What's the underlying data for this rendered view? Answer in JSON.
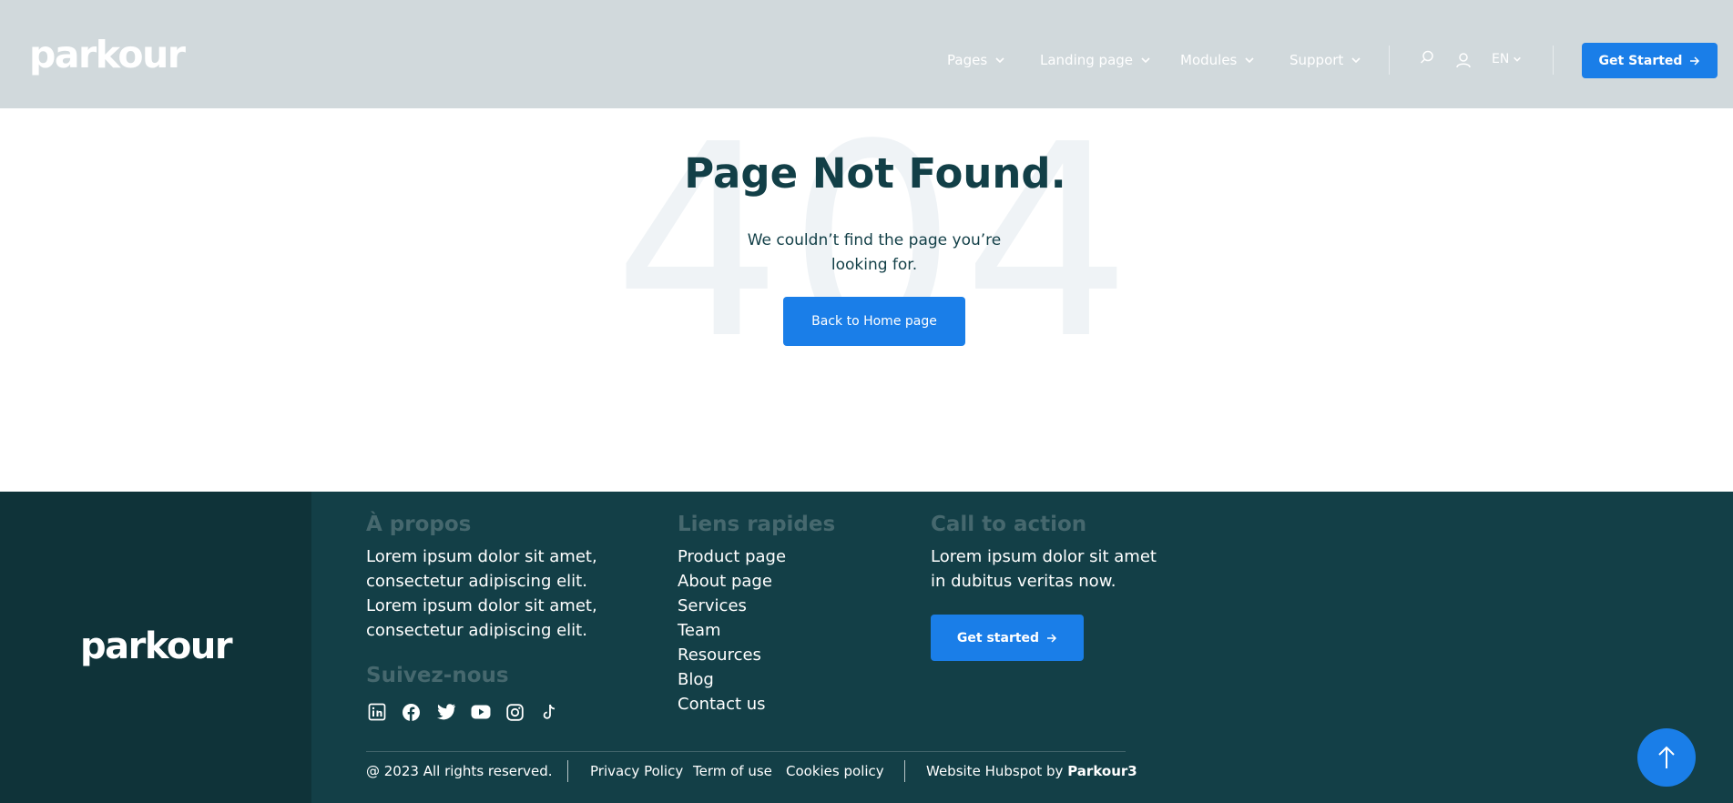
{
  "header": {
    "logo": "parkour",
    "nav": [
      {
        "label": "Pages"
      },
      {
        "label": "Landing page"
      },
      {
        "label": "Modules"
      },
      {
        "label": "Support"
      }
    ],
    "lang": "EN",
    "cta_label": "Get Started"
  },
  "main": {
    "bg_code": "404",
    "title": "Page Not Found.",
    "subtitle": "We couldn’t find the page you’re looking for.",
    "button_label": "Back to Home page"
  },
  "footer": {
    "logo": "parkour",
    "about": {
      "heading": "À propos",
      "text": "Lorem ipsum dolor sit amet, consectetur adipiscing elit. Lorem ipsum dolor sit amet, consectetur adipiscing elit."
    },
    "follow_heading": "Suivez-nous",
    "socials": [
      "linkedin-icon",
      "facebook-icon",
      "twitter-icon",
      "youtube-icon",
      "instagram-icon",
      "tiktok-icon"
    ],
    "quick_links": {
      "heading": "Liens rapides",
      "items": [
        "Product page",
        "About page",
        "Services",
        "Team",
        "Resources",
        "Blog",
        "Contact us"
      ]
    },
    "cta": {
      "heading": "Call to action",
      "text": "Lorem ipsum dolor sit amet in dubitus veritas now.",
      "button_label": "Get started"
    },
    "bottom": {
      "copyright": "@ 2023 All rights reserved.",
      "privacy": "Privacy Policy",
      "terms": "Term of use",
      "cookies": "Cookies policy",
      "credit_prefix": "Website Hubspot by",
      "credit_name": "Parkour3"
    }
  },
  "colors": {
    "header_bg": "#d1d9dc",
    "accent": "#1a7ee8",
    "footer_bg": "#133f47",
    "footer_left_bg": "#0f3339",
    "text_dark": "#123f47"
  }
}
